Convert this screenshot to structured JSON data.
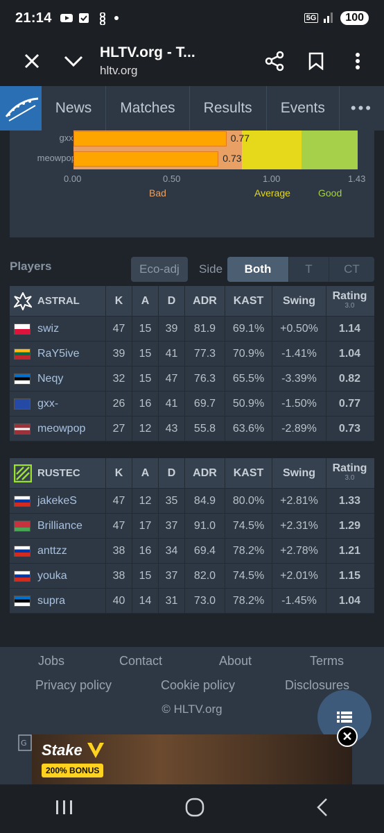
{
  "status": {
    "time": "21:14",
    "network": "5G",
    "battery": "100"
  },
  "browser": {
    "title": "HLTV.org - T...",
    "url": "hltv.org"
  },
  "nav": {
    "items": [
      "News",
      "Matches",
      "Results",
      "Events"
    ],
    "more": "•••"
  },
  "chart_data": {
    "type": "bar",
    "orientation": "horizontal",
    "categories": [
      "gxx-",
      "meowpop"
    ],
    "values": [
      0.77,
      0.73
    ],
    "value_labels": [
      "0.77",
      "0.73"
    ],
    "xlim": [
      0.0,
      1.43
    ],
    "ticks": [
      "0.00",
      "0.50",
      "1.00",
      "1.43"
    ],
    "zones": [
      {
        "label": "Bad",
        "color": "#e8a064"
      },
      {
        "label": "Average",
        "color": "#e6d91c"
      },
      {
        "label": "Good",
        "color": "#a6d04a"
      }
    ],
    "bar_color": "#ffa500"
  },
  "players_header": {
    "title": "Players",
    "eco_adj": "Eco-adj",
    "side_label": "Side",
    "sides": [
      "Both",
      "T",
      "CT"
    ],
    "active_side": "Both"
  },
  "columns": {
    "k": "K",
    "a": "A",
    "d": "D",
    "adr": "ADR",
    "kast": "KAST",
    "swing": "Swing",
    "rating": "Rating",
    "rating_version": "3.0"
  },
  "teams": [
    {
      "name": "ASTRAL",
      "players": [
        {
          "name": "swiz",
          "flag": "Poland",
          "k": "47",
          "a": "15",
          "d": "39",
          "adr": "81.9",
          "kast": "69.1%",
          "swing": "+0.50%",
          "rating": "1.14",
          "swing_class": "swneu",
          "rating_class": "pos"
        },
        {
          "name": "RaY5ive",
          "flag": "Lithuania",
          "k": "39",
          "a": "15",
          "d": "41",
          "adr": "77.3",
          "kast": "70.9%",
          "swing": "-1.41%",
          "rating": "1.04",
          "swing_class": "swneg",
          "rating_class": "neu"
        },
        {
          "name": "Neqy",
          "flag": "Estonia",
          "k": "32",
          "a": "15",
          "d": "47",
          "adr": "76.3",
          "kast": "65.5%",
          "swing": "-3.39%",
          "rating": "0.82",
          "swing_class": "swneg",
          "rating_class": "neg"
        },
        {
          "name": "gxx-",
          "flag": "Kosovo",
          "k": "26",
          "a": "16",
          "d": "41",
          "adr": "69.7",
          "kast": "50.9%",
          "swing": "-1.50%",
          "rating": "0.77",
          "swing_class": "swneg",
          "rating_class": "neg"
        },
        {
          "name": "meowpop",
          "flag": "Latvia",
          "k": "27",
          "a": "12",
          "d": "43",
          "adr": "55.8",
          "kast": "63.6%",
          "swing": "-2.89%",
          "rating": "0.73",
          "swing_class": "swneg",
          "rating_class": "neg"
        }
      ]
    },
    {
      "name": "RUSTEC",
      "players": [
        {
          "name": "jakekeS",
          "flag": "Russia",
          "k": "47",
          "a": "12",
          "d": "35",
          "adr": "84.9",
          "kast": "80.0%",
          "swing": "+2.81%",
          "rating": "1.33",
          "swing_class": "swpos",
          "rating_class": "pos"
        },
        {
          "name": "Brilliance",
          "flag": "Belarus",
          "k": "47",
          "a": "17",
          "d": "37",
          "adr": "91.0",
          "kast": "74.5%",
          "swing": "+2.31%",
          "rating": "1.29",
          "swing_class": "swpos",
          "rating_class": "pos"
        },
        {
          "name": "anttzz",
          "flag": "Russia",
          "k": "38",
          "a": "16",
          "d": "34",
          "adr": "69.4",
          "kast": "78.2%",
          "swing": "+2.78%",
          "rating": "1.21",
          "swing_class": "swpos",
          "rating_class": "pos"
        },
        {
          "name": "youka",
          "flag": "Russia",
          "k": "38",
          "a": "15",
          "d": "37",
          "adr": "82.0",
          "kast": "74.5%",
          "swing": "+2.01%",
          "rating": "1.15",
          "swing_class": "swpos",
          "rating_class": "pos"
        },
        {
          "name": "supra",
          "flag": "Estonia",
          "k": "40",
          "a": "14",
          "d": "31",
          "adr": "73.0",
          "kast": "78.2%",
          "swing": "-1.45%",
          "rating": "1.04",
          "swing_class": "swneg",
          "rating_class": "neu"
        }
      ]
    }
  ],
  "footer": {
    "links": [
      "Jobs",
      "Contact",
      "About",
      "Terms",
      "Privacy policy",
      "Cookie policy",
      "Disclosures"
    ],
    "copyright": "© HLTV.org"
  },
  "ad": {
    "brand": "Stake",
    "bonus": "200% BONUS"
  }
}
